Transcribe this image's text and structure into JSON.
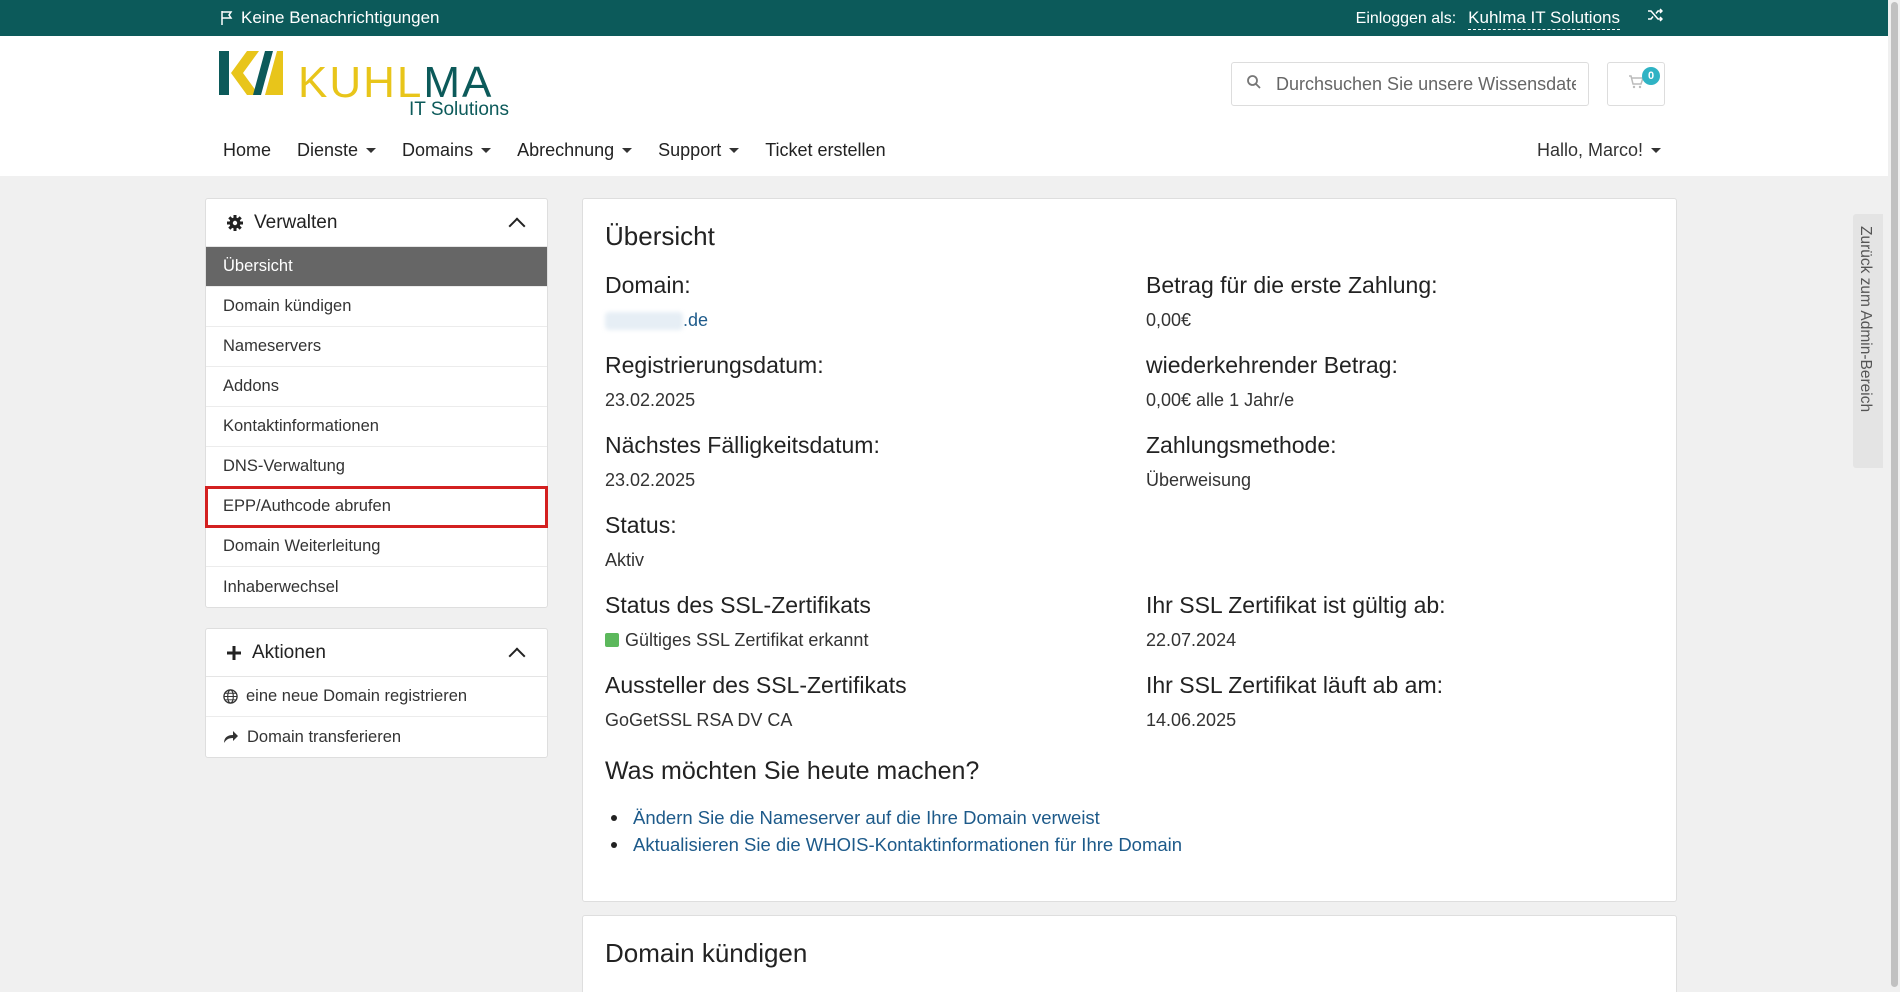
{
  "topbar": {
    "notifications": "Keine Benachrichtigungen",
    "login_label": "Einloggen als:",
    "login_user": "Kuhlma IT Solutions"
  },
  "header": {
    "logo_k": "KUHL",
    "logo_m": "MA",
    "logo_sub": "IT Solutions",
    "search_placeholder": "Durchsuchen Sie unsere Wissensdatenbank...",
    "cart_count": "0"
  },
  "nav": {
    "home": "Home",
    "dienste": "Dienste",
    "domains": "Domains",
    "abrechnung": "Abrechnung",
    "support": "Support",
    "ticket": "Ticket erstellen",
    "user": "Hallo, Marco!"
  },
  "sidebar": {
    "manage_title": "Verwalten",
    "items": [
      "Übersicht",
      "Domain kündigen",
      "Nameservers",
      "Addons",
      "Kontaktinformationen",
      "DNS-Verwaltung",
      "EPP/Authcode abrufen",
      "Domain Weiterleitung",
      "Inhaberwechsel"
    ],
    "actions_title": "Aktionen",
    "actions": [
      "eine neue Domain registrieren",
      "Domain transferieren"
    ]
  },
  "overview": {
    "title": "Übersicht",
    "domain_label": "Domain:",
    "domain_value": ".de",
    "first_payment_label": "Betrag für die erste Zahlung:",
    "first_payment_value": "0,00€",
    "reg_date_label": "Registrierungsdatum:",
    "reg_date_value": "23.02.2025",
    "recurring_label": "wiederkehrender Betrag:",
    "recurring_value": "0,00€ alle 1 Jahr/e",
    "due_label": "Nächstes Fälligkeitsdatum:",
    "due_value": "23.02.2025",
    "payment_method_label": "Zahlungsmethode:",
    "payment_method_value": "Überweisung",
    "status_label": "Status:",
    "status_value": "Aktiv",
    "ssl_status_label": "Status des SSL-Zertifikats",
    "ssl_status_value": "Gültiges SSL Zertifikat erkannt",
    "ssl_valid_from_label": "Ihr SSL Zertifikat ist gültig ab:",
    "ssl_valid_from_value": "22.07.2024",
    "ssl_issuer_label": "Aussteller des SSL-Zertifikats",
    "ssl_issuer_value": "GoGetSSL RSA DV CA",
    "ssl_expires_label": "Ihr SSL Zertifikat läuft ab am:",
    "ssl_expires_value": "14.06.2025",
    "todo_title": "Was möchten Sie heute machen?",
    "todo_links": [
      "Ändern Sie die Nameserver auf die Ihre Domain verweist",
      "Aktualisieren Sie die WHOIS-Kontaktinformationen für Ihre Domain"
    ]
  },
  "cancel_card": {
    "title": "Domain kündigen"
  },
  "side_tab": "Zurück zum Admin-Bereich"
}
